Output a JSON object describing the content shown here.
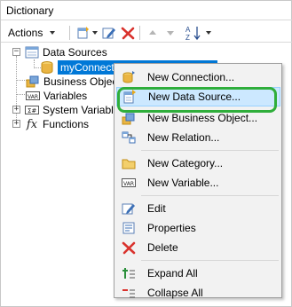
{
  "window": {
    "title": "Dictionary"
  },
  "toolbar": {
    "actions_label": "Actions"
  },
  "tree": {
    "data_sources": "Data Sources",
    "connection": "myConnection [SQL Connection]",
    "business_objects": "Business Objects",
    "variables": "Variables",
    "system_variables": "System Variables",
    "functions": "Functions"
  },
  "menu": {
    "items": [
      {
        "label": "New Connection..."
      },
      {
        "label": "New Data Source..."
      },
      {
        "label": "New Business Object..."
      },
      {
        "label": "New Relation..."
      },
      {
        "label": "New Category..."
      },
      {
        "label": "New Variable..."
      },
      {
        "label": "Edit"
      },
      {
        "label": "Properties"
      },
      {
        "label": "Delete"
      },
      {
        "label": "Expand All"
      },
      {
        "label": "Collapse All"
      }
    ]
  },
  "colors": {
    "selection": "#0078d7",
    "menu_highlight": "#cce8ff",
    "annotation_ring": "#2fae3b",
    "delete_red": "#d9322d"
  }
}
